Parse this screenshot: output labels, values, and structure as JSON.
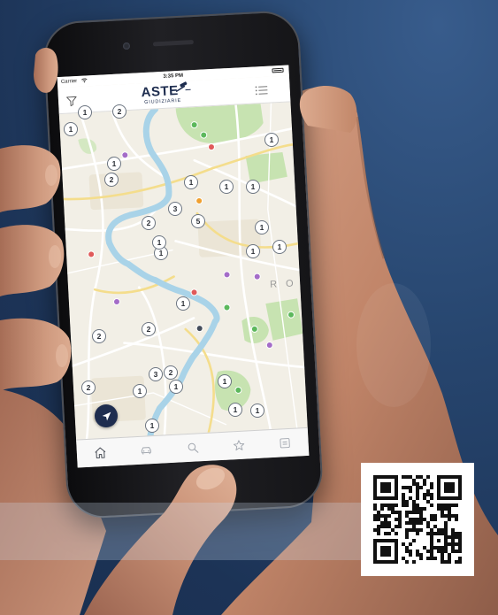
{
  "status_bar": {
    "carrier": "Carrier",
    "time": "3:35 PM",
    "wifi_icon": "wifi-icon",
    "battery_icon": "battery-icon"
  },
  "header": {
    "filter_icon": "filter-icon",
    "logo_main": "ASTE",
    "logo_icon": "gavel-icon",
    "logo_sub": "GIUDIZIARIE",
    "menu_icon": "list-menu-icon"
  },
  "map": {
    "area_label": "RO",
    "clusters": [
      "1",
      "2",
      "1",
      "1",
      "1",
      "2",
      "1",
      "1",
      "1",
      "3",
      "2",
      "5",
      "1",
      "1",
      "1",
      "1",
      "1",
      "1",
      "2",
      "2",
      "3",
      "2",
      "1",
      "1",
      "1",
      "2",
      "1",
      "1",
      "1"
    ]
  },
  "location_button": {
    "icon": "location-arrow-icon"
  },
  "tab_bar": {
    "items": [
      {
        "icon": "home-icon",
        "active": true
      },
      {
        "icon": "car-icon",
        "active": false
      },
      {
        "icon": "search-icon",
        "active": false
      },
      {
        "icon": "star-icon",
        "active": false
      },
      {
        "icon": "list-icon",
        "active": false
      }
    ]
  },
  "colors": {
    "background": "#1f3a60",
    "brand_navy": "#1d2c4e",
    "map_land": "#f2efe6",
    "park": "#c7e3b1",
    "river": "#a9d3e8",
    "cluster_border": "#6b7480",
    "qr_background": "#ffffff"
  }
}
